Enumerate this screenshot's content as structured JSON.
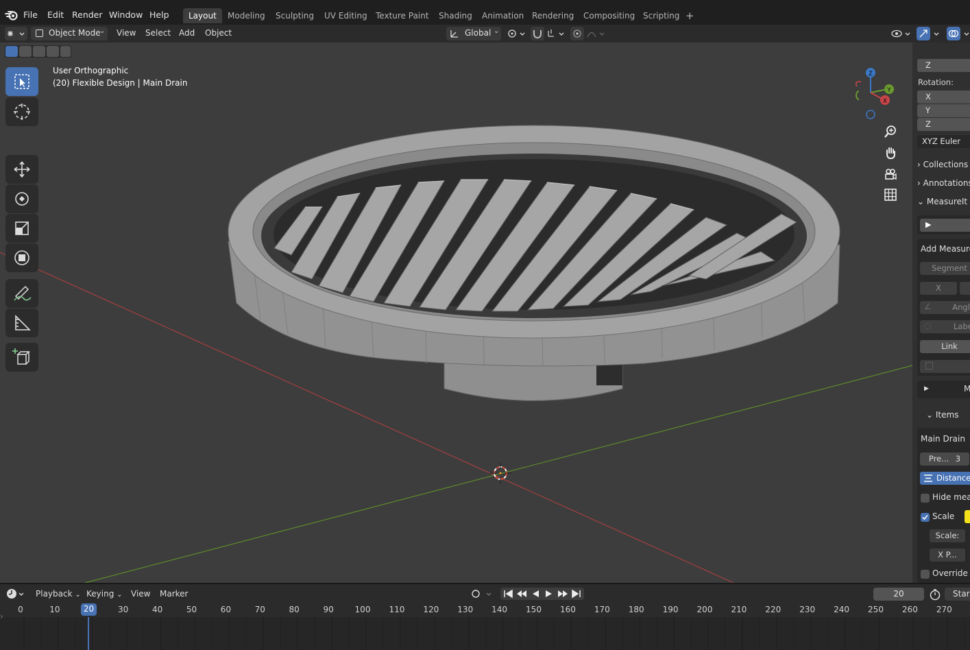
{
  "menu": {
    "items": [
      "File",
      "Edit",
      "Render",
      "Window",
      "Help"
    ]
  },
  "workspaces": {
    "tabs": [
      "Layout",
      "Modeling",
      "Sculpting",
      "UV Editing",
      "Texture Paint",
      "Shading",
      "Animation",
      "Rendering",
      "Compositing",
      "Scripting"
    ],
    "active": "Layout",
    "add_symbol": "+"
  },
  "viewport_header": {
    "mode": "Object Mode",
    "menus": [
      "View",
      "Select",
      "Add",
      "Object"
    ],
    "transform_orientation": "Global"
  },
  "viewport": {
    "view_name": "User Orthographic",
    "object_info": "(20) Flexible Design | Main Drain",
    "gizmo_axes": [
      "Z",
      "Y",
      "X"
    ],
    "colors": {
      "x_axis": "#c94549",
      "y_axis": "#6b9a2e",
      "z_axis": "#3b79c7"
    }
  },
  "sidebar": {
    "location_z": "Z",
    "rotation_label": "Rotation:",
    "rotation_axes": [
      "X",
      "Y",
      "Z"
    ],
    "rotation_mode": "XYZ Euler",
    "panels": {
      "collections": "Collections",
      "annotations": "Annotations",
      "measureit": "MeasureIt T"
    },
    "run_button": "S",
    "add_measures": "Add Measure",
    "segment": "Segment",
    "x_button": "X",
    "angle": "Angle",
    "label": "Label",
    "link": "Link",
    "m_button": "M",
    "items_header": "Items",
    "object_name": "Main Drain",
    "preset": "Pre...",
    "preset_value": "3",
    "distance_button": "Distance",
    "hide_measure": "Hide meas",
    "scale_label": "Scale",
    "scale_field": "Scale:",
    "x_pos": "X P...",
    "override": "Override"
  },
  "timeline": {
    "menus": [
      "Playback",
      "Keying",
      "View",
      "Marker"
    ],
    "current_frame": "20",
    "start_label": "Start",
    "ticks": [
      "0",
      "10",
      "20",
      "30",
      "40",
      "50",
      "60",
      "70",
      "80",
      "90",
      "100",
      "110",
      "120",
      "130",
      "140",
      "150",
      "160",
      "170",
      "180",
      "190",
      "200",
      "210",
      "220",
      "230",
      "240",
      "250",
      "260",
      "270"
    ],
    "highlighted_tick": "20"
  }
}
